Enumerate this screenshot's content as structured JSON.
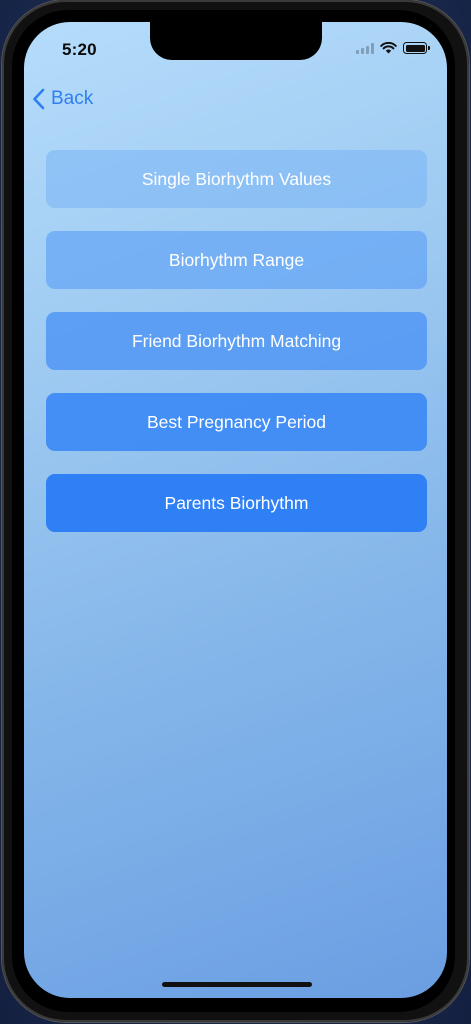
{
  "status_bar": {
    "time": "5:20",
    "icons": [
      "cellular-signal-icon",
      "wifi-icon",
      "battery-icon"
    ]
  },
  "nav": {
    "back_label": "Back",
    "back_icon": "chevron-left-icon"
  },
  "menu": {
    "items": [
      {
        "label": "Single Biorhythm Values"
      },
      {
        "label": "Biorhythm Range"
      },
      {
        "label": "Friend Biorhythm Matching"
      },
      {
        "label": "Best Pregnancy Period"
      },
      {
        "label": "Parents Biorhythm"
      }
    ]
  },
  "colors": {
    "accent": "#2f80f5",
    "back_link": "#2f7ff0",
    "background_top": "#b5dcfb",
    "background_bottom": "#6a9ee2"
  }
}
